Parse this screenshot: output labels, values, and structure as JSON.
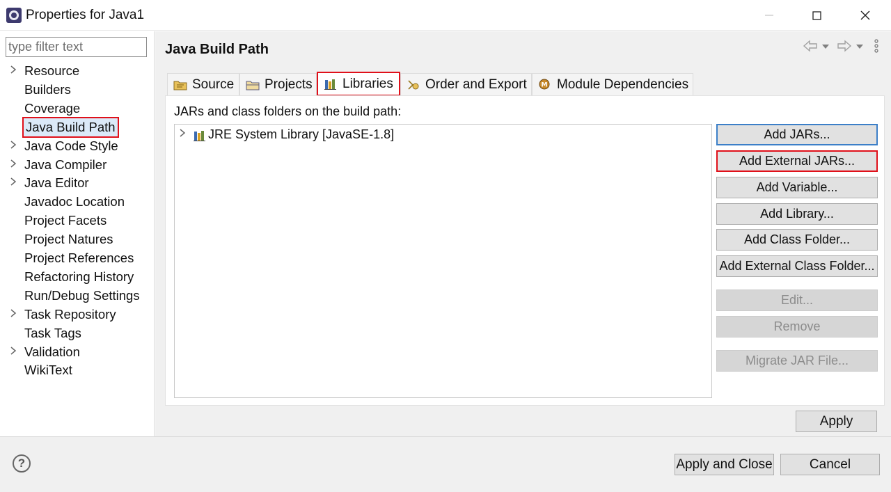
{
  "window": {
    "title": "Properties for Java1",
    "min": "—",
    "max": "☐",
    "close": "✕"
  },
  "filter": {
    "placeholder": "type filter text"
  },
  "tree": [
    {
      "label": "Resource",
      "expandable": true
    },
    {
      "label": "Builders",
      "expandable": false
    },
    {
      "label": "Coverage",
      "expandable": false
    },
    {
      "label": "Java Build Path",
      "expandable": false,
      "selected": true
    },
    {
      "label": "Java Code Style",
      "expandable": true
    },
    {
      "label": "Java Compiler",
      "expandable": true
    },
    {
      "label": "Java Editor",
      "expandable": true
    },
    {
      "label": "Javadoc Location",
      "expandable": false
    },
    {
      "label": "Project Facets",
      "expandable": false
    },
    {
      "label": "Project Natures",
      "expandable": false
    },
    {
      "label": "Project References",
      "expandable": false
    },
    {
      "label": "Refactoring History",
      "expandable": false
    },
    {
      "label": "Run/Debug Settings",
      "expandable": false
    },
    {
      "label": "Task Repository",
      "expandable": true
    },
    {
      "label": "Task Tags",
      "expandable": false
    },
    {
      "label": "Validation",
      "expandable": true
    },
    {
      "label": "WikiText",
      "expandable": false
    }
  ],
  "page": {
    "title": "Java Build Path",
    "tabs": [
      "Source",
      "Projects",
      "Libraries",
      "Order and Export",
      "Module Dependencies"
    ],
    "active_tab": "Libraries",
    "build_label": "JARs and class folders on the build path:",
    "library_entry": "JRE System Library [JavaSE-1.8]",
    "buttons": {
      "add_jars": "Add JARs...",
      "add_external_jars": "Add External JARs...",
      "add_variable": "Add Variable...",
      "add_library": "Add Library...",
      "add_class_folder": "Add Class Folder...",
      "add_external_class_folder": "Add External Class Folder...",
      "edit": "Edit...",
      "remove": "Remove",
      "migrate": "Migrate JAR File..."
    },
    "apply": "Apply"
  },
  "footer": {
    "help": "?",
    "apply_and_close": "Apply and Close",
    "cancel": "Cancel"
  },
  "colors": {
    "highlight_red": "#e0101a",
    "focus_blue": "#3c7fc8",
    "selection_bg": "#dbe9f8"
  }
}
